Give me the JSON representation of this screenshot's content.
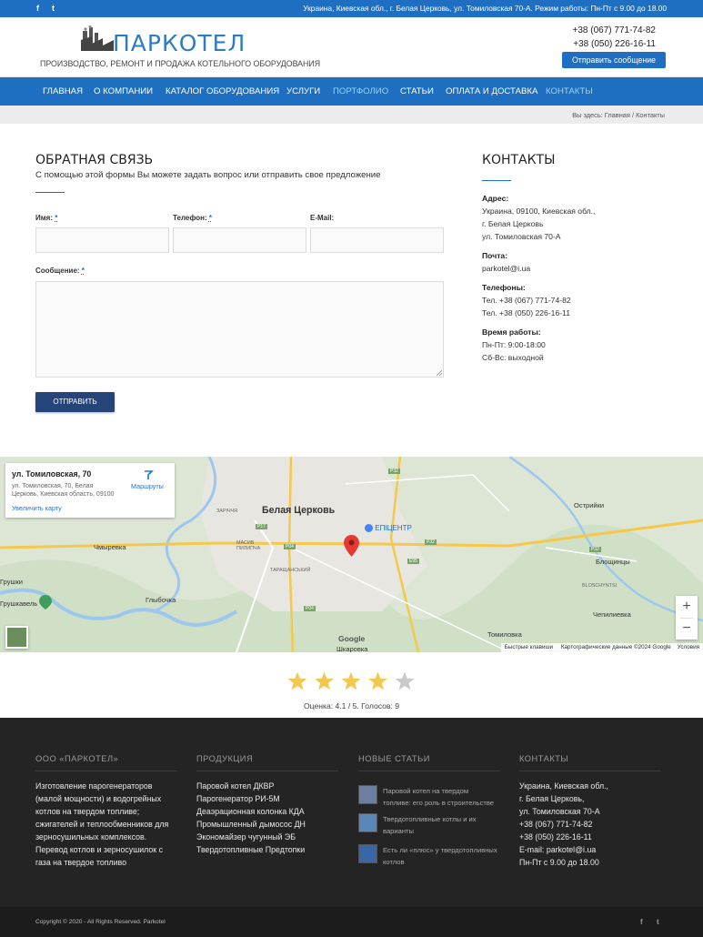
{
  "topbar": {
    "social": [
      "f",
      "t"
    ],
    "address": "Украина, Киевская обл., г. Белая Церковь, ул. Томиловская 70-А. Режим работы: Пн-Пт с 9.00 до 18.00"
  },
  "header": {
    "logo_name": "ПАРКОТЕЛ",
    "tagline": "ПРОИЗВОДСТВО, РЕМОНТ И ПРОДАЖА КОТЕЛЬНОГО ОБОРУДОВАНИЯ",
    "phones": [
      "+38 (067) 771-74-82",
      "+38 (050) 226-16-11"
    ],
    "send_label": "Отправить сообщение"
  },
  "nav": {
    "items": [
      {
        "label": "ГЛАВНАЯ"
      },
      {
        "label": "О КОМПАНИИ"
      },
      {
        "label": "КАТАЛОГ ОБОРУДОВАНИЯ"
      },
      {
        "label": "УСЛУГИ"
      },
      {
        "label": "ПОРТФОЛИО"
      },
      {
        "label": "СТАТЬИ"
      },
      {
        "label": "ОПЛАТА И ДОСТАВКА"
      },
      {
        "label": "КОНТАКТЫ"
      }
    ]
  },
  "breadcrumb": "Вы здесь:  Главная  /  Контакты",
  "form": {
    "title": "ОБРАТНАЯ СВЯЗЬ",
    "subtitle": "С помощью этой формы Вы можете задать вопрос или отправить свое предложение",
    "name_label": "Имя:",
    "phone_label": "Телефон:",
    "email_label": "E-Mail:",
    "message_label": "Сообщение:",
    "required_mark": "*",
    "submit_label": "ОТПРАВИТЬ"
  },
  "contacts": {
    "title": "КОНТАКТЫ",
    "address_label": "Адрес:",
    "address_lines": [
      "Украина, 09100, Киевская обл.,",
      "г. Белая Церковь",
      "ул. Томиловская 70-А"
    ],
    "mail_label": "Почта:",
    "mail": "parkotel@i.ua",
    "phones_label": "Телефоны:",
    "phones": [
      "Тел. +38 (067) 771-74-82",
      "Тел. +38 (050) 226-16-11"
    ],
    "hours_label": "Время работы:",
    "hours": [
      "Пн-Пт: 9:00-18:00",
      "Сб-Вс: выходной"
    ]
  },
  "map": {
    "card_title": "ул. Томиловская, 70",
    "card_address": [
      "ул. Томиловская, 70, Белая",
      "Церковь, Киевская область, 09100"
    ],
    "routes_label": "Маршруты",
    "enlarge_label": "Увеличить карту",
    "city": "Белая Церковь",
    "labels": [
      "ЗАРІЧЧЯ",
      "МАСИВ ПИЛИПЧА",
      "ТАРАЩАНСЬКИЙ",
      "Чмыревка",
      "Глыбочка",
      "Острийки",
      "Блощинцы",
      "BLOSCHYNTSI",
      "Чепилиевка",
      "Томиловка",
      "Шкаровка",
      "Грушки",
      "Грушкавель"
    ],
    "roads": [
      "P32",
      "P17",
      "P04",
      "E95",
      "P32",
      "P04",
      "P32"
    ],
    "epicenter": "ЕПІЦЕНТР",
    "google": "Google",
    "footer_items": [
      "Быстрые клавиши",
      "Картографические данные ©2024 Google",
      "Условия"
    ],
    "zoom_in": "+",
    "zoom_out": "−"
  },
  "rating": {
    "value": 4.1,
    "max": 5,
    "text": "Оценка: 4.1 / 5. Голосов: 9",
    "star_color": "#f2c84f",
    "empty_star_color": "#c9c9c9"
  },
  "footer": {
    "company_title": "ООО «ПАРКОТЕЛ»",
    "company_text": [
      "Изготовление парогенераторов",
      "(малой мощности) и водогрейных",
      "котлов на твердом топливе;",
      "сжигателей и теплообменников для",
      "зерносушильных комплексов.",
      "Перевод котлов и зерносушилок с",
      "газа на твердое топливо"
    ],
    "products_title": "ПРОДУКЦИЯ",
    "products": [
      "Паровой котел ДКВР",
      "Парогенератор РИ-5М",
      "Деаэрационная колонка КДА",
      "Промышленный дымосос ДН",
      "Экономайзер чугунный ЭБ",
      "Твердотопливные Предтопки"
    ],
    "articles_title": "НОВЫЕ СТАТЬИ",
    "articles": [
      [
        "Паровой котел на твердом",
        "топливе: его роль в строительстве"
      ],
      [
        "Твердотопливные котлы и их",
        "варианты"
      ],
      [
        "Есть ли «плюс» у твердотопливных",
        "котлов"
      ]
    ],
    "contacts_title": "КОНТАКТЫ",
    "contacts": [
      "Украина, Киевская обл.,",
      "г. Белая Церковь,",
      "ул. Томиловская 70-А",
      "+38 (067) 771-74-82",
      "+38 (050) 226-16-11",
      "E-mail: parkotel@i.ua",
      "Пн-Пт с 9.00 до 18.00"
    ],
    "copyright": "Copyright © 2020 - All Rights Reserved. Parkotel",
    "social": [
      "f",
      "t"
    ]
  }
}
